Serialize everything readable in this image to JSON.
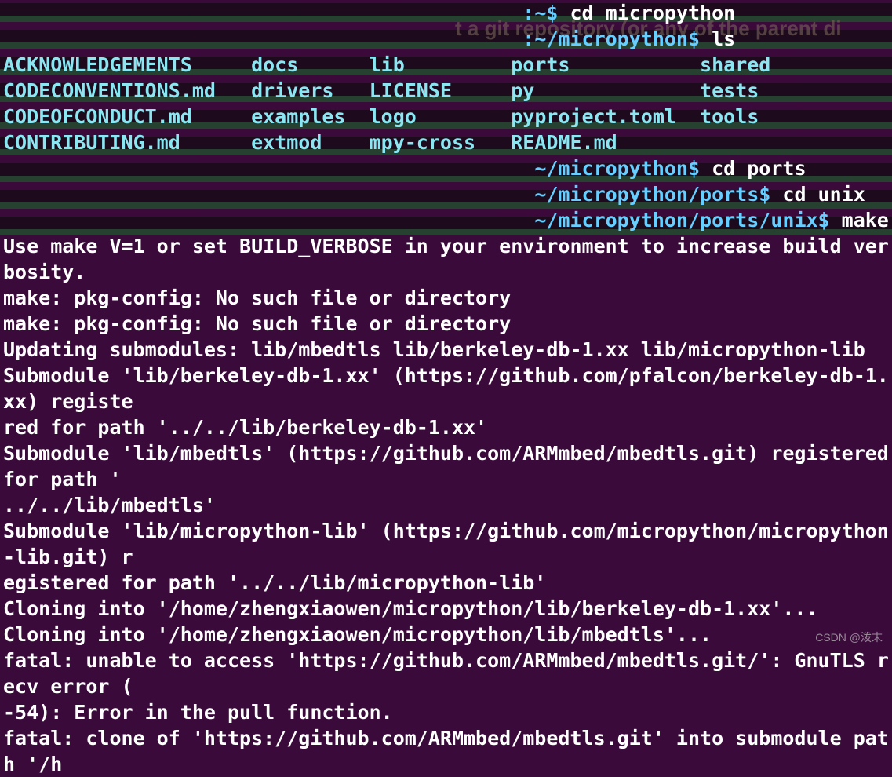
{
  "bg": {
    "title_fragment": "t a git repository (or any of the parent di"
  },
  "lines": {
    "p1_path": ":~$ ",
    "p1_cmd": "cd micropython",
    "p2_path": ":~/micropython$ ",
    "p2_cmd": "ls",
    "ls": {
      "c1": [
        "ACKNOWLEDGEMENTS",
        "CODECONVENTIONS.md",
        "CODEOFCONDUCT.md",
        "CONTRIBUTING.md"
      ],
      "c2": [
        "docs",
        "drivers",
        "examples",
        "extmod"
      ],
      "c3": [
        "lib",
        "LICENSE",
        "logo",
        "mpy-cross"
      ],
      "c4": [
        "ports",
        "py",
        "pyproject.toml",
        "README.md"
      ],
      "c5": [
        "shared",
        "tests",
        "tools",
        ""
      ]
    },
    "p3_path": "~/micropython$ ",
    "p3_cmd": "cd ports",
    "p4_path": "~/micropython/ports$ ",
    "p4_cmd": "cd unix",
    "p5_path": "~/micropython/ports/unix$ ",
    "p5_cmd": "make submodules",
    "out": [
      "Use make V=1 or set BUILD_VERBOSE in your environment to increase build verbosity.",
      "make: pkg-config: No such file or directory",
      "make: pkg-config: No such file or directory",
      "Updating submodules: lib/mbedtls lib/berkeley-db-1.xx lib/micropython-lib",
      "Submodule 'lib/berkeley-db-1.xx' (https://github.com/pfalcon/berkeley-db-1.xx) registered for path '../../lib/berkeley-db-1.xx'",
      "Submodule 'lib/mbedtls' (https://github.com/ARMmbed/mbedtls.git) registered for path '../../lib/mbedtls'",
      "Submodule 'lib/micropython-lib' (https://github.com/micropython/micropython-lib.git) registered for path '../../lib/micropython-lib'",
      "Cloning into '/home/zhengxiaowen/micropython/lib/berkeley-db-1.xx'...",
      "Cloning into '/home/zhengxiaowen/micropython/lib/mbedtls'...",
      "fatal: unable to access 'https://github.com/ARMmbed/mbedtls.git/': GnuTLS recv error (-54): Error in the pull function.",
      "fatal: clone of 'https://github.com/ARMmbed/mbedtls.git' into submodule path '/h"
    ]
  },
  "watermark": "CSDN @泼末"
}
